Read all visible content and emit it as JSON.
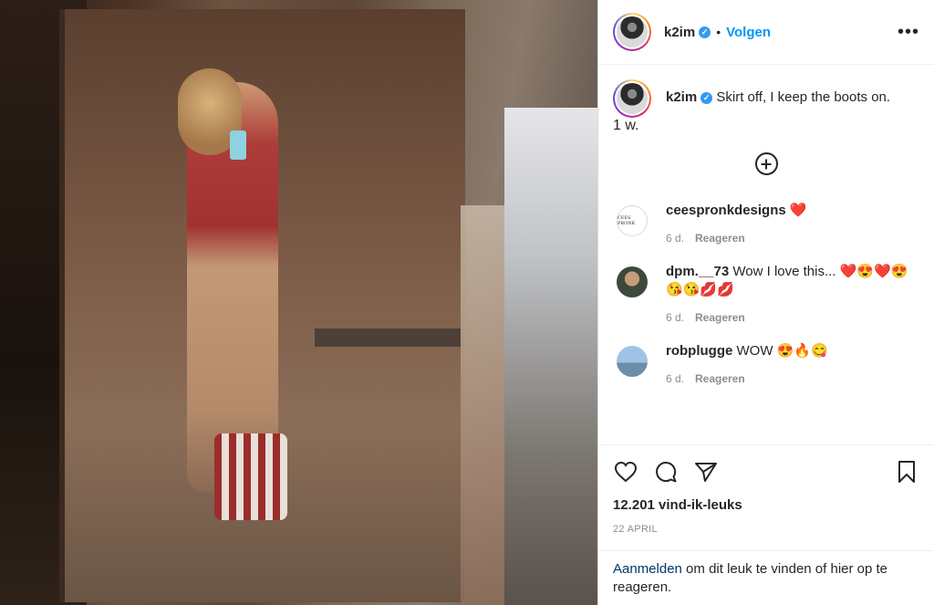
{
  "post": {
    "username": "k2im",
    "follow_label": "Volgen",
    "dot": "•",
    "more_label": "•••",
    "verified_mark": "✓",
    "caption": "Skirt off, I keep the boots on.",
    "caption_age": "1 w.",
    "likes": "12.201 vind-ik-leuks",
    "date": "22 APRIL"
  },
  "comments": [
    {
      "user": "ceespronkdesigns",
      "text": "❤️",
      "age": "6 d.",
      "reply": "Reageren",
      "avatar_text": "CEES PRONK"
    },
    {
      "user": "dpm.__73",
      "text": "Wow I love this... ❤️😍❤️😍😘😘💋💋",
      "age": "6 d.",
      "reply": "Reageren"
    },
    {
      "user": "robplugge",
      "text": "WOW 😍🔥😋",
      "age": "6 d.",
      "reply": "Reageren"
    }
  ],
  "login": {
    "link": "Aanmelden",
    "rest": " om dit leuk te vinden of hier op te reageren."
  },
  "icons": {
    "more": "more-options-icon",
    "load_more": "plus-circle-icon",
    "like": "heart-icon",
    "comment": "comment-icon",
    "share": "share-icon",
    "save": "bookmark-icon",
    "verified": "verified-badge-icon"
  }
}
